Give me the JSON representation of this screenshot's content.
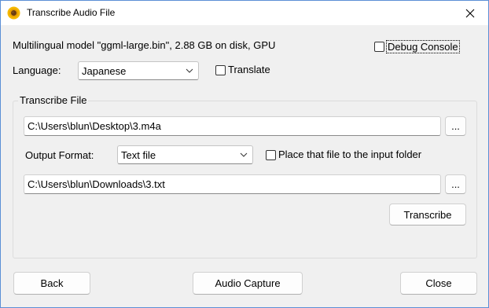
{
  "window": {
    "title": "Transcribe Audio File"
  },
  "model_info": "Multilingual model \"ggml-large.bin\", 2.88 GB on disk, GPU",
  "debug_console": {
    "label": "Debug Console",
    "checked": false
  },
  "language": {
    "label": "Language:",
    "value": "Japanese"
  },
  "translate": {
    "label": "Translate",
    "checked": false
  },
  "transcribe_group": {
    "title": "Transcribe File",
    "input_path": "C:\\Users\\blun\\Desktop\\3.m4a",
    "browse_label": "...",
    "output_format_label": "Output Format:",
    "output_format_value": "Text file",
    "place_in_input_folder": {
      "label": "Place that file to the input folder",
      "checked": false
    },
    "output_path": "C:\\Users\\blun\\Downloads\\3.txt",
    "transcribe_label": "Transcribe"
  },
  "footer": {
    "back_label": "Back",
    "audio_capture_label": "Audio Capture",
    "close_label": "Close"
  }
}
